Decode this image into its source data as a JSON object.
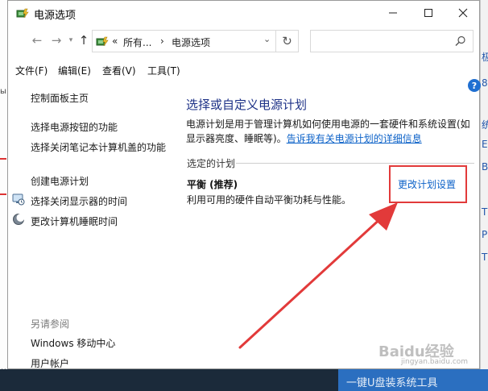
{
  "window": {
    "title": "电源选项"
  },
  "address": {
    "crumb_prefix": "«",
    "crumb_1": "所有...",
    "crumb_sep": "›",
    "crumb_2": "电源选项",
    "dropdown_arrow": "⌄"
  },
  "menu": [
    "文件(F)",
    "编辑(E)",
    "查看(V)",
    "工具(T)"
  ],
  "left_pane": {
    "home": "控制面板主页",
    "links": [
      "选择电源按钮的功能",
      "选择关闭笔记本计算机盖的功能",
      "创建电源计划",
      "选择关闭显示器的时间",
      "更改计算机睡眠时间"
    ],
    "see_also_label": "另请参阅",
    "see_also": [
      "Windows 移动中心",
      "用户帐户"
    ]
  },
  "main": {
    "heading": "选择或自定义电源计划",
    "description": "电源计划是用于管理计算机如何使用电源的一套硬件和系统设置(如显示器亮度、睡眠等)。",
    "description_link": "告诉我有关电源计划的详细信息",
    "section_label": "选定的计划",
    "plan_name": "平衡 (推荐)",
    "plan_desc": "利用可用的硬件自动平衡功耗与性能。",
    "change_plan": "更改计划设置"
  },
  "help_icon": "?",
  "icons": {
    "title": "power-options-icon",
    "back": "arrow-left-icon",
    "forward": "arrow-right-icon",
    "recent": "chevron-down-icon",
    "up": "arrow-up-icon",
    "refresh": "refresh-icon",
    "search": "search-icon",
    "display": "monitor-clock-icon",
    "sleep": "moon-icon"
  },
  "annotation": {
    "color": "#e23a3a"
  },
  "background": {
    "right_chars": [
      "极",
      "8",
      "统",
      "E",
      "B",
      "T",
      "P",
      "T"
    ],
    "left_chars": [
      "ы",
      "的"
    ],
    "bottom_text": "一键U盘装系统工具",
    "watermark": "Baidu经验",
    "watermark_sub": "jingyan.baidu.com"
  },
  "colors": {
    "heading": "#1e3287",
    "link": "#0c62c8",
    "highlight": "#e23a3a"
  }
}
